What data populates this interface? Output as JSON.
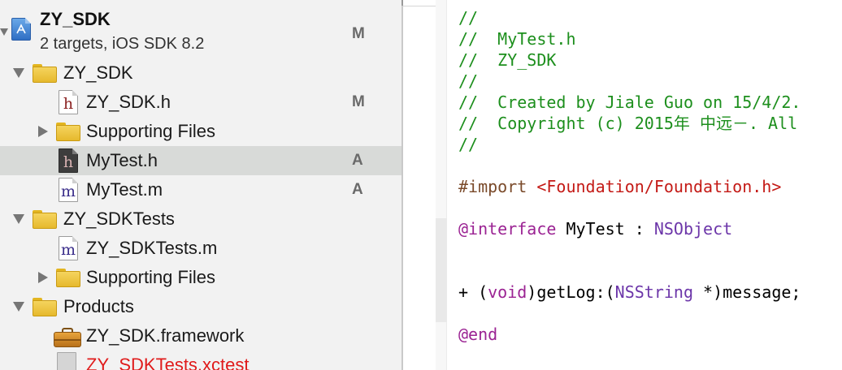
{
  "navigator": {
    "project": {
      "name": "ZY_SDK",
      "subtitle": "2 targets, iOS SDK 8.2",
      "badge": "M"
    },
    "rows": [
      {
        "label": "ZY_SDK",
        "badge": ""
      },
      {
        "label": "ZY_SDK.h",
        "badge": "M",
        "icon_glyph": "h"
      },
      {
        "label": "Supporting Files",
        "badge": ""
      },
      {
        "label": "MyTest.h",
        "badge": "A",
        "icon_glyph": "h",
        "selected": true
      },
      {
        "label": "MyTest.m",
        "badge": "A",
        "icon_glyph": "m"
      },
      {
        "label": "ZY_SDKTests",
        "badge": ""
      },
      {
        "label": "ZY_SDKTests.m",
        "badge": "",
        "icon_glyph": "m"
      },
      {
        "label": "Supporting Files",
        "badge": ""
      },
      {
        "label": "Products",
        "badge": ""
      },
      {
        "label": "ZY_SDK.framework",
        "badge": ""
      },
      {
        "label": "ZY_SDKTests.xctest",
        "badge": "",
        "color": "#e01b1b"
      }
    ]
  },
  "editor": {
    "lines": [
      {
        "comment": "//"
      },
      {
        "comment": "//  MyTest.h"
      },
      {
        "comment": "//  ZY_SDK"
      },
      {
        "comment": "//"
      },
      {
        "comment": "//  Created by Jiale Guo on 15/4/2."
      },
      {
        "comment": "//  Copyright (c) 2015年 中远－. All"
      },
      {
        "comment": "//"
      },
      {
        "directive": "#import ",
        "path": "<Foundation/Foundation.h>"
      },
      {
        "keyword": "@interface",
        "name": " MyTest : ",
        "superclass": "NSObject"
      },
      {
        "prefix": "+ (",
        "return_type": "void",
        "selector": ")getLog:(",
        "param_type": "NSString",
        "suffix": " *)message;"
      },
      {
        "keyword": "@end"
      }
    ]
  },
  "colors": {
    "comment": "#1d8f1d",
    "string": "#c41a16",
    "keyword": "#9b2393",
    "type": "#6c36a9",
    "selection": "#d8dad8"
  }
}
